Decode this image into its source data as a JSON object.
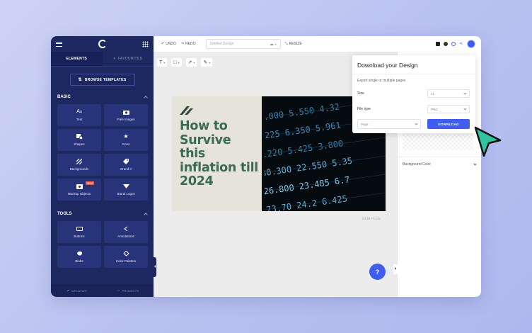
{
  "sidebar": {
    "tabs": [
      "ELEMENTS",
      "FAVOURITES"
    ],
    "browse_label": "BROWSE TEMPLATES",
    "basic": {
      "title": "BASIC",
      "items": [
        {
          "label": "Text",
          "icon": "text-icon"
        },
        {
          "label": "Free Images",
          "icon": "camera-icon"
        },
        {
          "label": "Shapes",
          "icon": "shapes-icon"
        },
        {
          "label": "Icons",
          "icon": "star-icon"
        },
        {
          "label": "Backgrounds",
          "icon": "backgrounds-icon"
        },
        {
          "label": "Brand it",
          "icon": "tag-icon"
        },
        {
          "label": "Mockup Objects",
          "icon": "mockup-icon",
          "badge": "NEW"
        },
        {
          "label": "Brand Logos",
          "icon": "brand-logos-icon"
        }
      ]
    },
    "tools": {
      "title": "TOOLS",
      "items": [
        {
          "label": "Buttons",
          "icon": "button-icon"
        },
        {
          "label": "Annotations",
          "icon": "annotation-icon"
        },
        {
          "label": "Blobs",
          "icon": "blob-icon"
        },
        {
          "label": "Color Palettes",
          "icon": "palette-icon"
        }
      ]
    },
    "bottom": [
      "UPLOADS",
      "PROJECTS"
    ]
  },
  "topbar": {
    "undo": "UNDO",
    "redo": "REDO",
    "design_name": "Untitled Design",
    "resize": "RESIZE"
  },
  "canvas": {
    "design_title": "How to Survive this inflation till 2024",
    "new_page": "NEW PAGE",
    "help": "?",
    "tools": [
      "T",
      "□",
      "↗",
      "✎"
    ]
  },
  "right_panel": {
    "background_color": "Background Color"
  },
  "download_modal": {
    "title": "Download your Design",
    "subtitle": "Export single or multiple pages",
    "size_label": "Size",
    "size_value": "x1",
    "filetype_label": "File type",
    "filetype_value": "PNG",
    "page_placeholder": "Page",
    "download_button": "DOWNLOAD"
  },
  "colors": {
    "sidebar": "#1d2760",
    "accent": "#3f5ef0",
    "title_green": "#3c6b52",
    "cursor": "#2ec4a0"
  }
}
